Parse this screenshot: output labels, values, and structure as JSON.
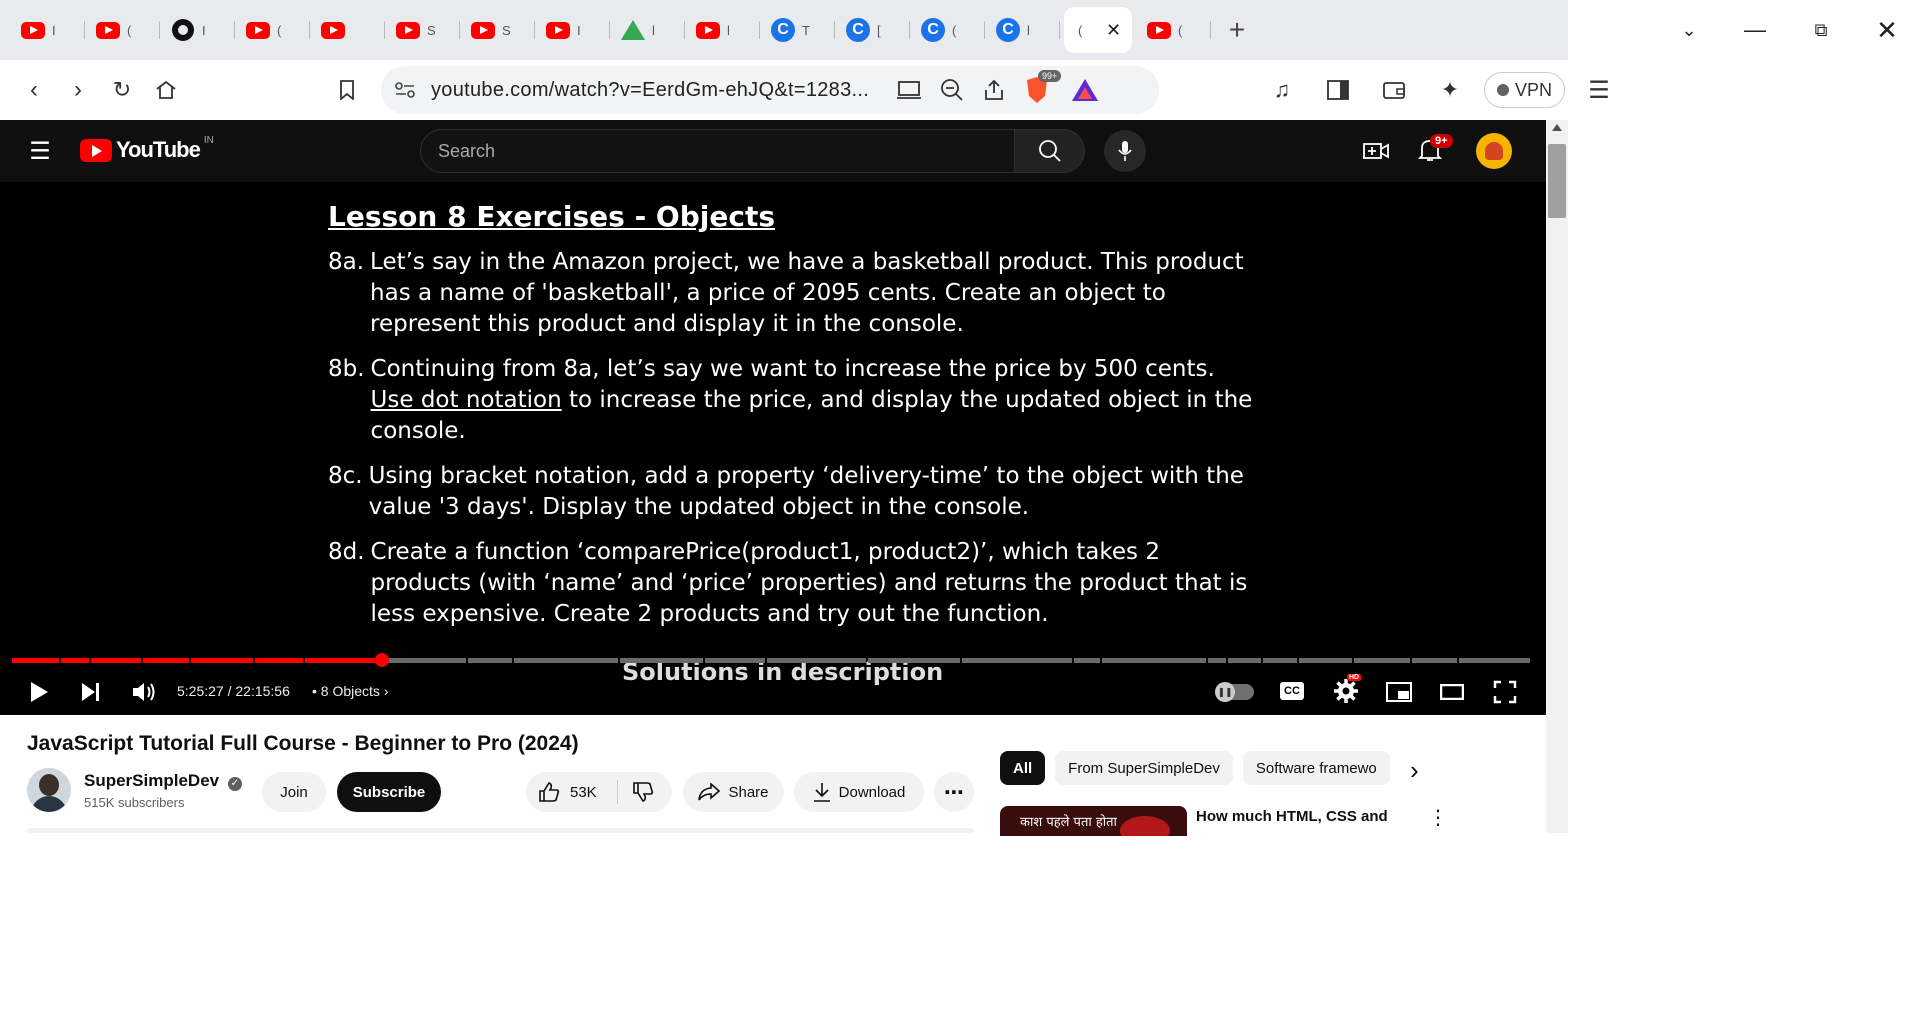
{
  "browser": {
    "tabs": [
      {
        "icon": "youtube-icon",
        "label": "I"
      },
      {
        "icon": "youtube-icon",
        "label": "("
      },
      {
        "icon": "github-icon",
        "label": "I"
      },
      {
        "icon": "youtube-icon",
        "label": "("
      },
      {
        "icon": "youtube-icon",
        "label": ""
      },
      {
        "icon": "youtube-icon",
        "label": "S"
      },
      {
        "icon": "youtube-icon",
        "label": "S"
      },
      {
        "icon": "youtube-icon",
        "label": "I"
      },
      {
        "icon": "google-drive-icon",
        "label": "l"
      },
      {
        "icon": "youtube-icon",
        "label": "l"
      },
      {
        "icon": "chrome-c-icon",
        "label": "T"
      },
      {
        "icon": "chrome-c-icon",
        "label": "["
      },
      {
        "icon": "chrome-c-icon",
        "label": "("
      },
      {
        "icon": "chrome-c-icon",
        "label": "l"
      },
      {
        "icon": "active-tab",
        "label": "("
      },
      {
        "icon": "youtube-icon",
        "label": "("
      }
    ],
    "url": "youtube.com/watch?v=EerdGm-ehJQ&t=1283...",
    "brave_badge": "99+",
    "vpn_label": "VPN"
  },
  "youtube": {
    "logo_text": "YouTube",
    "region": "IN",
    "search_placeholder": "Search",
    "notification_badge": "9+"
  },
  "slide": {
    "title": "Lesson 8 Exercises - Objects",
    "exercises": [
      {
        "label": "8a.",
        "text": "Let’s say in the Amazon project, we have a basketball product. This product has a name of 'basketball', a price of 2095 cents. Create an object to represent this product and display it in the console."
      },
      {
        "label": "8b.",
        "pre": "Continuing from 8a, let’s say we want to increase the price by 500 cents. ",
        "underlined": "Use dot notation",
        "post": " to increase the price, and display the updated object in the console."
      },
      {
        "label": "8c.",
        "text": "Using bracket notation, add a property ‘delivery-time’ to the object with the value '3 days'. Display the updated object in the console."
      },
      {
        "label": "8d.",
        "text": "Create a function ‘comparePrice(product1, product2)’, which takes 2 products (with ‘name’ and ‘price’ properties) and returns the product that is less expensive. Create 2 products and try out the function."
      }
    ],
    "footer": "Solutions in description"
  },
  "player": {
    "current_time": "5:25:27",
    "duration": "22:15:56",
    "time_display": "5:25:27 / 22:15:56",
    "chapter": "8 Objects",
    "progress_fraction": 0.2437
  },
  "video": {
    "title": "JavaScript Tutorial Full Course - Beginner to Pro (2024)",
    "channel": "SuperSimpleDev",
    "subscribers": "515K subscribers",
    "join_label": "Join",
    "subscribe_label": "Subscribe",
    "likes": "53K",
    "share_label": "Share",
    "download_label": "Download"
  },
  "sidebar": {
    "chips": [
      "All",
      "From SuperSimpleDev",
      "Software framewo"
    ],
    "first_item_title": "How much HTML, CSS and",
    "first_thumb_text": "काश पहले पता होता"
  },
  "colors": {
    "youtube_red": "#ff0000",
    "player_bg": "#000000",
    "header_bg": "#0f0f0f"
  }
}
